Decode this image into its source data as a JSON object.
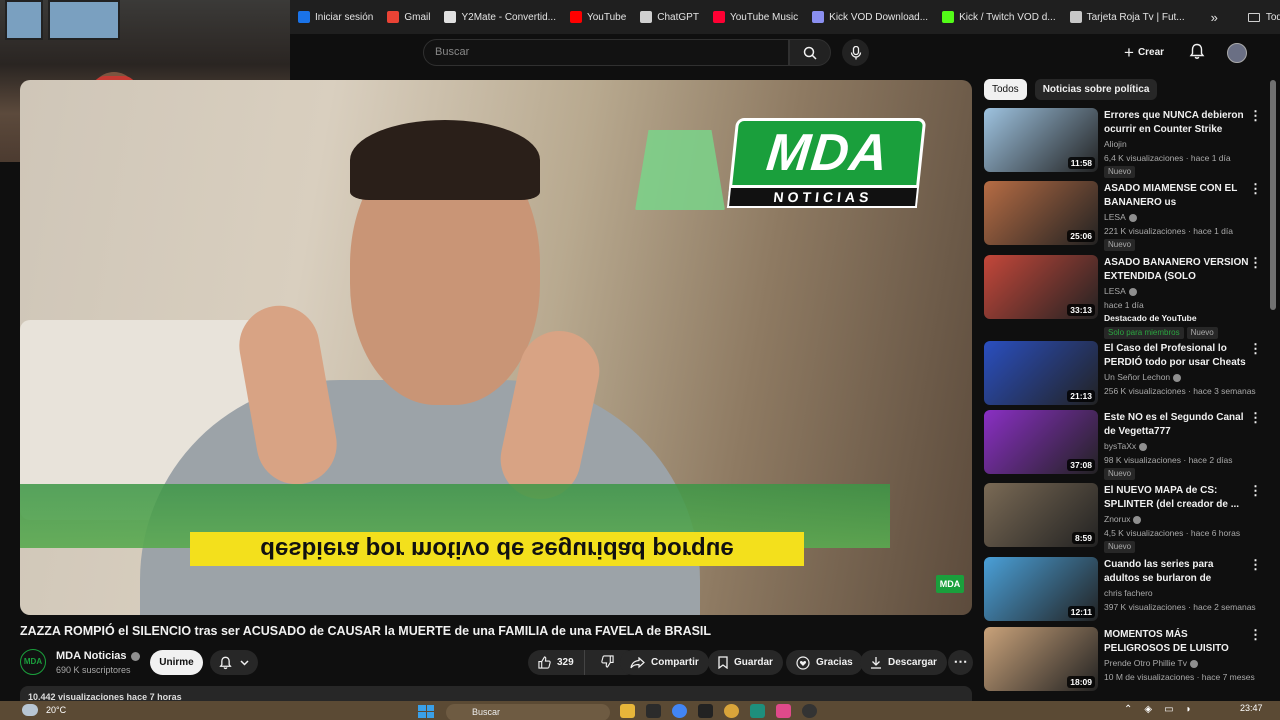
{
  "bookmarks": [
    {
      "label": "Iniciar sesión",
      "color": "#1a73e8"
    },
    {
      "label": "Gmail",
      "color": "#ea4335"
    },
    {
      "label": "Y2Mate - Convertid...",
      "color": "#e0e0e0"
    },
    {
      "label": "YouTube",
      "color": "#ff0000"
    },
    {
      "label": "ChatGPT",
      "color": "#d0d0d0"
    },
    {
      "label": "YouTube Music",
      "color": "#ff0033"
    },
    {
      "label": "Kick VOD Download...",
      "color": "#8a8ff0"
    },
    {
      "label": "Kick / Twitch VOD d...",
      "color": "#53fc18"
    },
    {
      "label": "Tarjeta Roja Tv | Fut...",
      "color": "#c8c8c8"
    }
  ],
  "bookmarks_overflow": "»",
  "bookmarks_folder": "Todos los marcadores",
  "header": {
    "search_placeholder": "Buscar",
    "create_label": "Crear"
  },
  "video": {
    "caption": "desbiera por motivo de seguridad porque",
    "logo_top": "MDA",
    "logo_bottom": "NOTICIAS",
    "watermark": "MDA",
    "title": "ZAZZA ROMPIÓ el SILENCIO tras ser ACUSADO de CAUSAR la MUERTE de una FAMILIA de una FAVELA de BRASIL"
  },
  "channel": {
    "avatar_text": "MDA",
    "name": "MDA Noticias",
    "subscribers": "690 K suscriptores",
    "join_label": "Unirme"
  },
  "actions": {
    "likes": "329",
    "share": "Compartir",
    "save": "Guardar",
    "thanks": "Gracias",
    "download": "Descargar"
  },
  "description_preview": "10.442 visualizaciones  hace 7 horas",
  "chips": [
    "Todos",
    "Noticias sobre política"
  ],
  "recommendations": [
    {
      "title": "Errores que NUNCA debieron ocurrir en Counter Strike",
      "channel": "Aliojin",
      "verified": false,
      "stats": "6,4 K visualizaciones · hace 1 día",
      "badge": "Nuevo",
      "duration": "11:58",
      "thumb_color": "#9ec3e0"
    },
    {
      "title": "ASADO MIAMENSE CON EL BANANERO us",
      "channel": "LESA",
      "verified": true,
      "stats": "221 K visualizaciones · hace 1 día",
      "badge": "Nuevo",
      "duration": "25:06",
      "thumb_color": "#b66c44"
    },
    {
      "title": "ASADO BANANERO VERSION EXTENDIDA (SOLO MIEMBROS)",
      "channel": "LESA",
      "verified": true,
      "stats": "hace 1 día",
      "extra": "Destacado de YouTube",
      "members": "Solo para miembros",
      "badge": "Nuevo",
      "duration": "33:13",
      "thumb_color": "#c4473a"
    },
    {
      "title": "El Caso del Profesional lo PERDIÓ todo por usar Cheats -...",
      "channel": "Un Señor Lechon",
      "verified": true,
      "stats": "256 K visualizaciones · hace 3 semanas",
      "duration": "21:13",
      "thumb_color": "#2a4fc0"
    },
    {
      "title": "Este NO es el Segundo Canal de Vegetta777",
      "channel": "bysTaXx",
      "verified": true,
      "stats": "98 K visualizaciones · hace 2 días",
      "badge": "Nuevo",
      "duration": "37:08",
      "thumb_color": "#8a2fc4"
    },
    {
      "title": "El NUEVO MAPA de CS: SPLINTER (del creador de ...",
      "channel": "Znorux",
      "verified": true,
      "stats": "4,5 K visualizaciones · hace 6 horas",
      "badge": "Nuevo",
      "duration": "8:59",
      "thumb_color": "#7a6a55"
    },
    {
      "title": "Cuando las series para adultos se burlaron de LATINOAMERICA",
      "channel": "chris fachero",
      "verified": false,
      "stats": "397 K visualizaciones · hace 2 semanas",
      "duration": "12:11",
      "thumb_color": "#4aa0d8"
    },
    {
      "title": "MOMENTOS MÁS PELIGROSOS DE LUISITO COMUNICA",
      "channel": "Prende Otro Phillie Tv",
      "verified": true,
      "stats": "10 M de visualizaciones · hace 7 meses",
      "duration": "18:09",
      "thumb_color": "#c9a27a"
    }
  ],
  "taskbar": {
    "temperature": "20°C",
    "search": "Buscar",
    "time": "23:47"
  }
}
